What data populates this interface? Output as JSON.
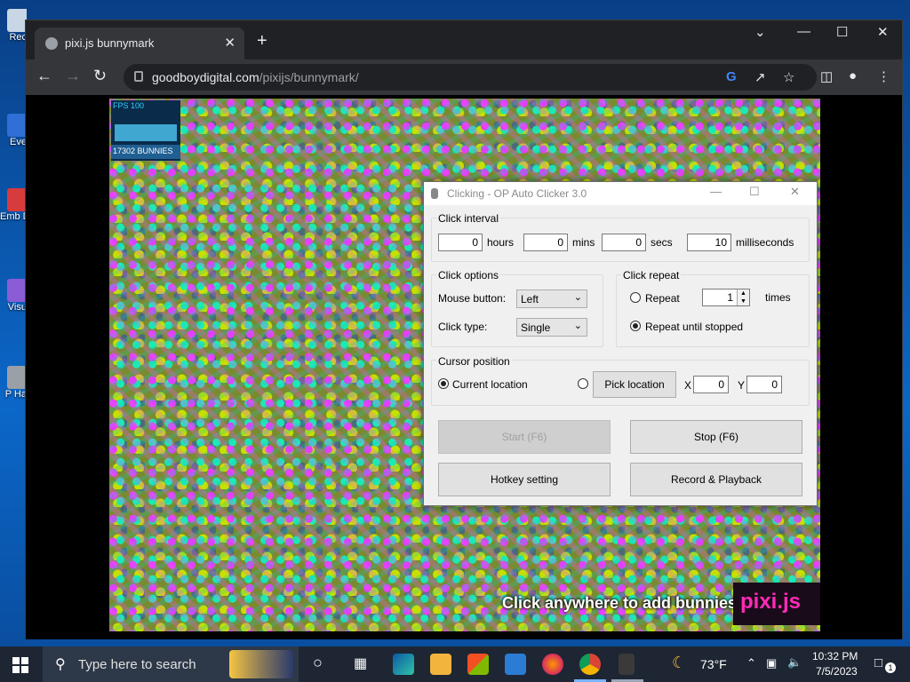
{
  "desktop": {
    "icons": [
      {
        "label": "Rec",
        "color": "#c8d6e6"
      },
      {
        "label": "Eve",
        "color": "#2f6fd6"
      },
      {
        "label": "Emb De",
        "color": "#d83b3b"
      },
      {
        "label": "Visu",
        "color": "#8a5cd6"
      },
      {
        "label": "P Ha",
        "color": "#9aa0a6"
      }
    ]
  },
  "browser": {
    "tab_title": "pixi.js bunnymark",
    "tab_close": "✕",
    "new_tab": "+",
    "url_host": "goodboydigital.com",
    "url_path": "/pixijs/bunnymark/"
  },
  "bunnymark": {
    "fps_text": "FPS 100",
    "bunny_count": "17302 BUNNIES",
    "click_message": "Click anywhere to add bunnies!",
    "logo_text": "pixi.js"
  },
  "autoclicker": {
    "title": "Clicking - OP Auto Clicker 3.0",
    "interval": {
      "label": "Click interval",
      "hours": "0",
      "hours_label": "hours",
      "mins": "0",
      "mins_label": "mins",
      "secs": "0",
      "secs_label": "secs",
      "ms": "10",
      "ms_label": "milliseconds"
    },
    "options": {
      "label": "Click options",
      "mouse_button_label": "Mouse button:",
      "mouse_button_value": "Left",
      "click_type_label": "Click type:",
      "click_type_value": "Single"
    },
    "repeat": {
      "label": "Click repeat",
      "repeat_label": "Repeat",
      "repeat_count": "1",
      "times_label": "times",
      "until_stopped_label": "Repeat until stopped",
      "selected": "until_stopped"
    },
    "cursor": {
      "label": "Cursor position",
      "current_label": "Current location",
      "pick_label": "Pick location",
      "x_label": "X",
      "x_value": "0",
      "y_label": "Y",
      "y_value": "0",
      "selected": "current"
    },
    "buttons": {
      "start": "Start (F6)",
      "stop": "Stop (F6)",
      "hotkey": "Hotkey setting",
      "record": "Record & Playback"
    }
  },
  "taskbar": {
    "search_placeholder": "Type here to search",
    "weather": "73°F",
    "time": "10:32 PM",
    "date": "7/5/2023",
    "notification_count": "1"
  }
}
